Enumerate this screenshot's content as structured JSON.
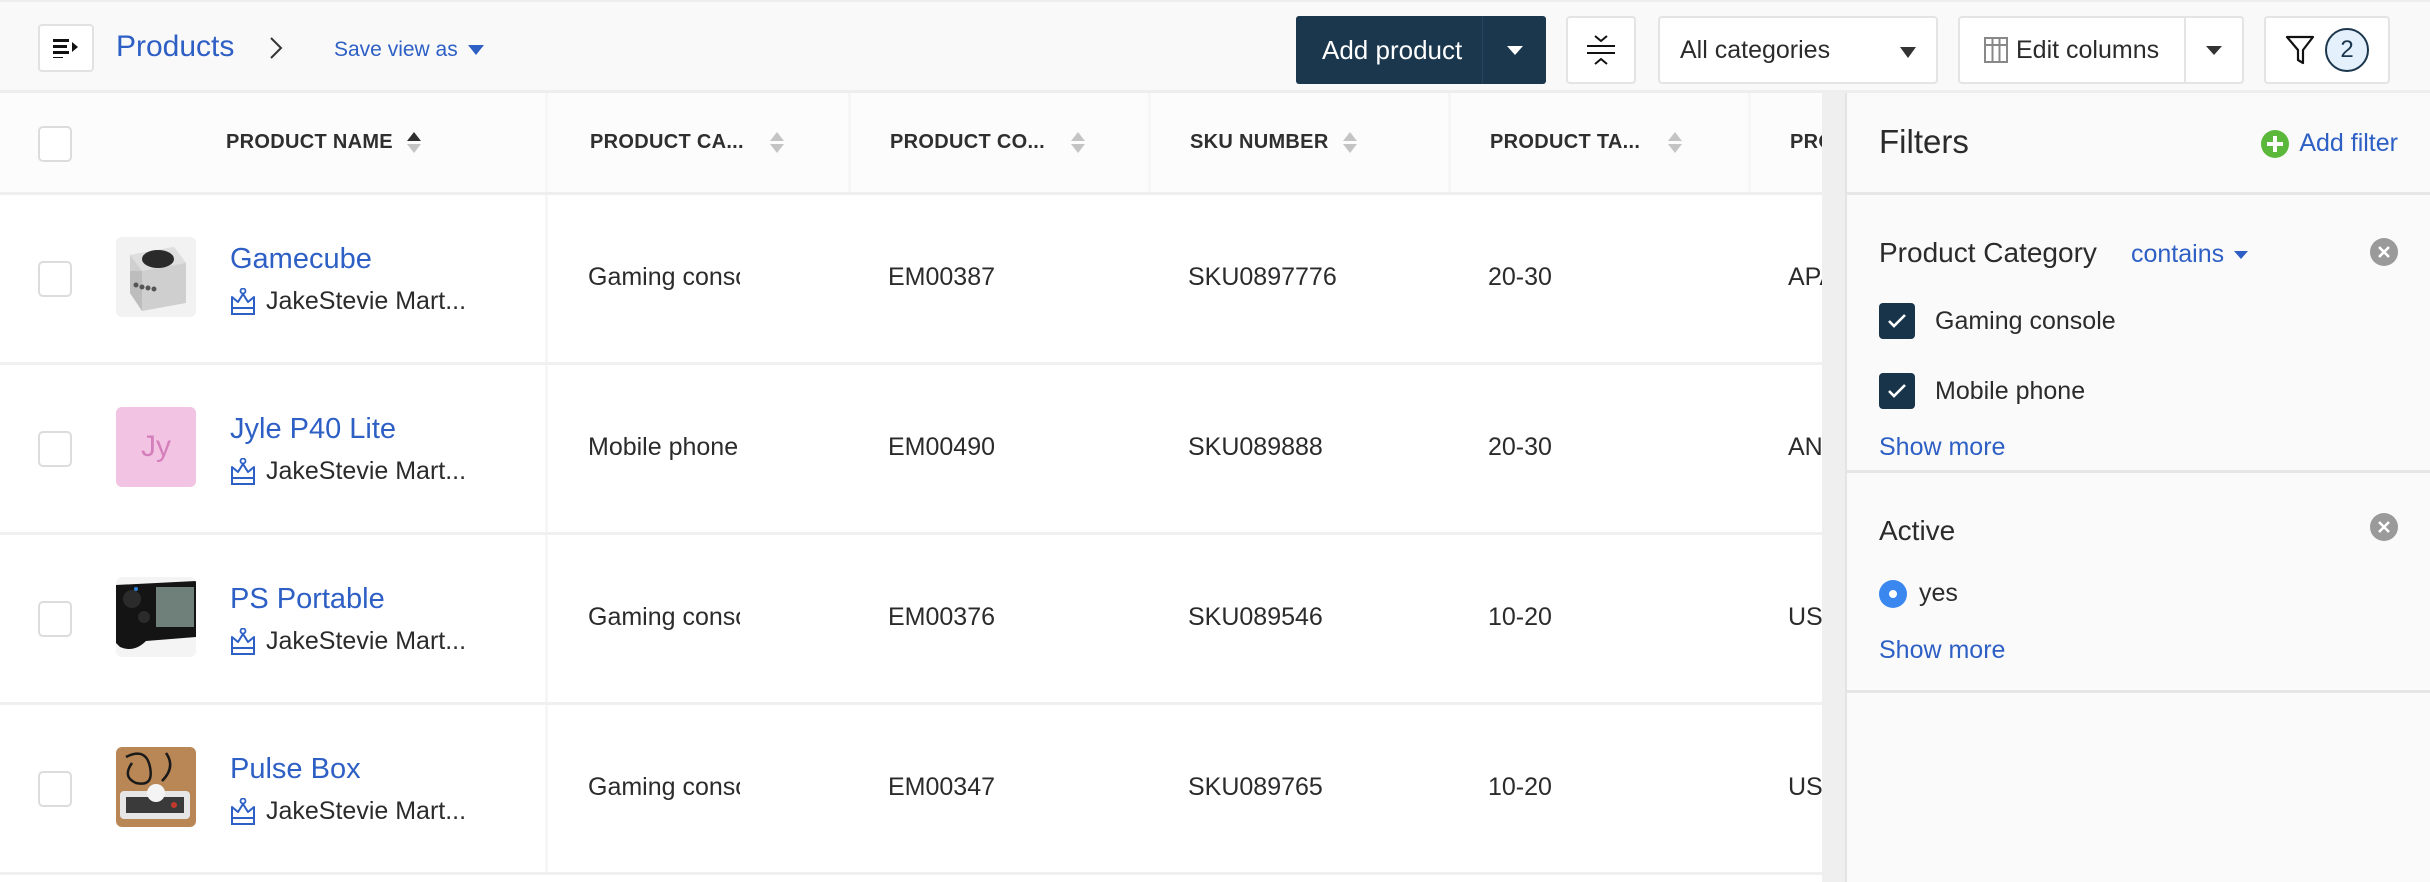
{
  "topbar": {
    "breadcrumb_root": "Products",
    "save_view_label": "Save view as",
    "add_product_label": "Add product",
    "category_select_value": "All categories",
    "edit_columns_label": "Edit columns",
    "active_filter_count": "2"
  },
  "table": {
    "columns": [
      {
        "label": "PRODUCT NAME",
        "sort": "ascending"
      },
      {
        "label": "PRODUCT CA...",
        "sort": "none"
      },
      {
        "label": "PRODUCT CO...",
        "sort": "none"
      },
      {
        "label": "SKU NUMBER",
        "sort": "none"
      },
      {
        "label": "PRODUCT TA...",
        "sort": "none"
      },
      {
        "label": "PRO",
        "sort": "none"
      }
    ],
    "rows": [
      {
        "name": "Gamecube",
        "owner": "JakeStevie Mart...",
        "thumb": "image",
        "initials": "",
        "category": "Gaming console",
        "code": "EM00387",
        "sku": "SKU0897776",
        "tag": "20-30",
        "extra": "APAC"
      },
      {
        "name": "Jyle P40 Lite",
        "owner": "JakeStevie Mart...",
        "thumb": "initials",
        "initials": "Jy",
        "category": "Mobile phone",
        "code": "EM00490",
        "sku": "SKU089888",
        "tag": "20-30",
        "extra": "ANZ"
      },
      {
        "name": "PS Portable",
        "owner": "JakeStevie Mart...",
        "thumb": "image",
        "initials": "",
        "category": "Gaming console",
        "code": "EM00376",
        "sku": "SKU089546",
        "tag": "10-20",
        "extra": "US"
      },
      {
        "name": "Pulse Box",
        "owner": "JakeStevie Mart...",
        "thumb": "image",
        "initials": "",
        "category": "Gaming console",
        "code": "EM00347",
        "sku": "SKU089765",
        "tag": "10-20",
        "extra": "US"
      }
    ]
  },
  "filters": {
    "title": "Filters",
    "add_filter_label": "Add filter",
    "sections": [
      {
        "title": "Product Category",
        "operator": "contains",
        "options": [
          {
            "label": "Gaming console",
            "checked": true
          },
          {
            "label": "Mobile phone",
            "checked": true
          }
        ],
        "show_more": "Show more"
      },
      {
        "title": "Active",
        "options": [
          {
            "label": "yes",
            "selected": true
          }
        ],
        "show_more": "Show more"
      }
    ]
  },
  "colors": {
    "primary_dark": "#1b374d",
    "link_blue": "#2d5fc4",
    "add_green": "#5cb83a",
    "radio_blue": "#3a87f0"
  }
}
